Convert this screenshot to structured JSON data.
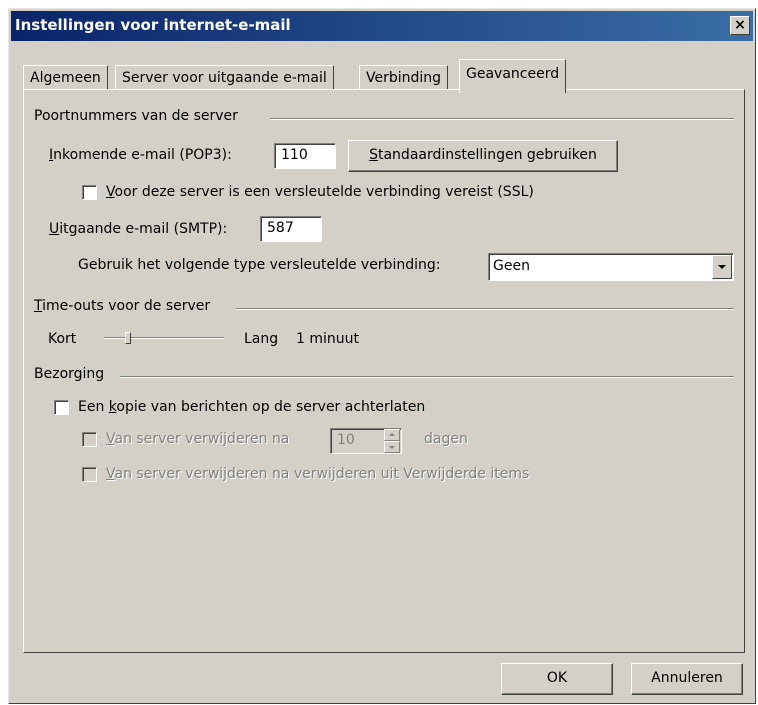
{
  "window": {
    "title": "Instellingen voor internet-e-mail",
    "close_label": "×"
  },
  "tabs": [
    {
      "label": "Algemeen"
    },
    {
      "label": "Server voor uitgaande e-mail"
    },
    {
      "label": "Verbinding"
    },
    {
      "label": "Geavanceerd",
      "active": true
    }
  ],
  "ports": {
    "group_title": "Poortnummers van de server",
    "incoming_label_accel": "I",
    "incoming_label_rest": "nkomende e-mail (POP3):",
    "incoming_value": "110",
    "defaults_button_accel": "S",
    "defaults_button_rest": "tandaardinstellingen gebruiken",
    "ssl_label_prefix": "V",
    "ssl_label_rest": "oor deze server is een versleutelde verbinding vereist (SSL)",
    "ssl_checked": false,
    "outgoing_label_accel": "U",
    "outgoing_label_rest": "itgaande e-mail (SMTP):",
    "outgoing_value": "587",
    "encryption_label": "Gebruik het volgende type versleutelde verbinding:",
    "encryption_value": "Geen"
  },
  "timeouts": {
    "group_title_accel": "T",
    "group_title_rest": "ime-outs voor de server",
    "short_label": "Kort",
    "long_label": "Lang",
    "value_label": "1 minuut",
    "slider_position": 0.2
  },
  "delivery": {
    "group_title": "Bezorging",
    "leave_copy_prefix": "Een ",
    "leave_copy_accel": "k",
    "leave_copy_rest": "opie van berichten op de server achterlaten",
    "leave_copy_checked": false,
    "remove_after_accel": "V",
    "remove_after_rest": "an server verwijderen na",
    "remove_after_days": "10",
    "days_label": "dagen",
    "remove_deleted_accel": "V",
    "remove_deleted_rest": "an server verwijderen na verwijderen uit Verwijderde items"
  },
  "footer": {
    "ok_label": "OK",
    "cancel_label": "Annuleren"
  },
  "colors": {
    "face": "#d4d0c8",
    "title_start": "#0a246a",
    "title_end": "#3a6ea5",
    "disabled_text": "#808080"
  }
}
